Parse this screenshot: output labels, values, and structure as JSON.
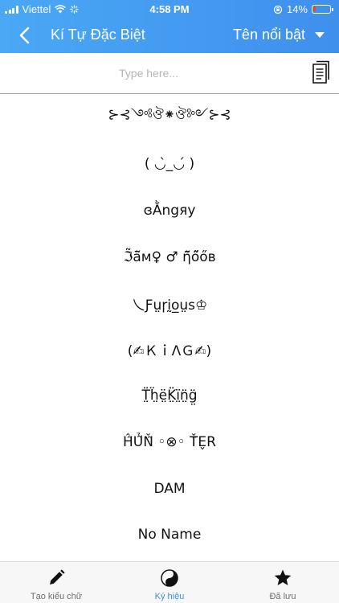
{
  "status_bar": {
    "carrier": "Viettel",
    "time": "4:58 PM",
    "battery_percent": "14%",
    "battery_level": 0.14,
    "battery_color": "#ff3b30"
  },
  "nav": {
    "back_icon": "chevron-left-icon",
    "title": "Kí Tự Đặc Biệt",
    "filter_label": "Tên nổi bật"
  },
  "input": {
    "placeholder": "Type here...",
    "value": "",
    "paste_icon": "clipboard-icon"
  },
  "symbols": [
    "⊱⊰༺ঔ⁕ঔ༻⊱⊰",
    "( ◡̀_◡́ )",
    "ɞẰngяy",
    "ℑ̃ā̃ᴍ♀ ♂ ῆ̃ő̃őʙ",
    "乀Ƒṳɼḭo̲ṳs♔",
    "(✍ＫｉΛＧ✍)",
    "T̤̈ḧ̤ë̤K̤̈ï̤n̤̈g̤̈",
    "Ĥ̃Ủ̃Ň̃ ◦⊗◦ Ť̃E̬R",
    "DAM",
    "No Name"
  ],
  "tabs": [
    {
      "label": "Tạo kiểu chữ",
      "icon": "pencil-icon",
      "active": false
    },
    {
      "label": "Ký hiệu",
      "icon": "yin-yang-icon",
      "active": true
    },
    {
      "label": "Đã lưu",
      "icon": "star-icon",
      "active": false
    }
  ],
  "colors": {
    "header_start": "#4aa8f5",
    "header_end": "#3f8fed",
    "tab_active": "#3b8fe6",
    "tab_inactive": "#6e6e6e"
  }
}
